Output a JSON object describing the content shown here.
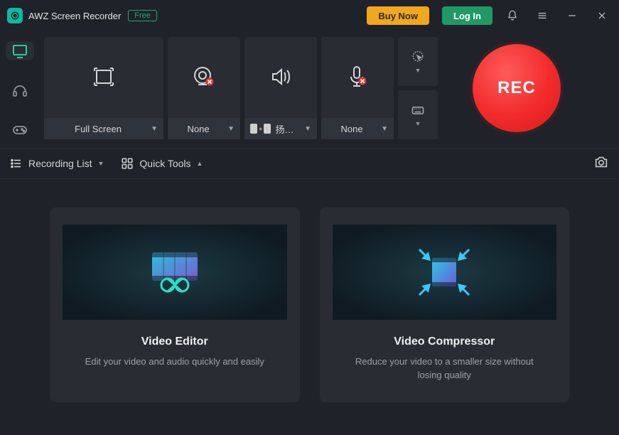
{
  "header": {
    "app_title": "AWZ Screen Recorder",
    "badge": "Free",
    "buy": "Buy Now",
    "login": "Log In"
  },
  "tiles": {
    "region": {
      "label": "Full Screen"
    },
    "webcam": {
      "label": "None"
    },
    "audio": {
      "label": "扬声器 (Rea..."
    },
    "mic": {
      "label": "None"
    }
  },
  "rec": {
    "label": "REC"
  },
  "toolbar": {
    "recording_list": "Recording List",
    "quick_tools": "Quick Tools"
  },
  "cards": {
    "editor": {
      "title": "Video Editor",
      "desc": "Edit your video and audio quickly and easily"
    },
    "compressor": {
      "title": "Video Compressor",
      "desc": "Reduce your video to a smaller size without losing quality"
    }
  }
}
